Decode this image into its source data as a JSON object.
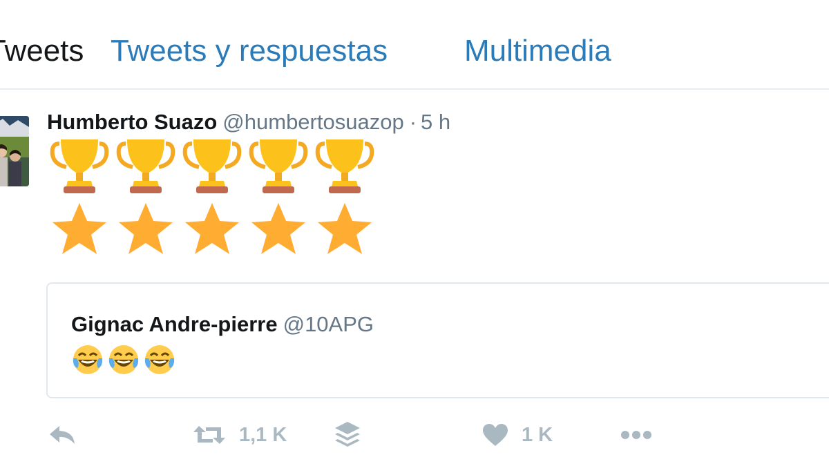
{
  "tabs": {
    "tweets": "Tweets",
    "replies": "Tweets y respuestas",
    "media": "Multimedia"
  },
  "tweet": {
    "author_name": "Humberto Suazo",
    "author_handle": "@humbertosuazop",
    "separator": "·",
    "time": "5 h",
    "content_emojis": [
      "trophy-emoji",
      "star-emoji"
    ],
    "trophy_count": 5,
    "star_count": 5,
    "quoted": {
      "author_name": "Gignac Andre-pierre",
      "author_handle": "@10APG",
      "emoji": "face-with-tears-of-joy-emoji",
      "emoji_count": 3
    },
    "actions": {
      "reply_icon": "reply-icon",
      "retweet_icon": "retweet-icon",
      "retweet_count": "1,1 K",
      "buffer_icon": "layers-icon",
      "like_icon": "heart-icon",
      "like_count": "1 K",
      "more_icon": "more-icon"
    }
  },
  "colors": {
    "tab_active": "#14171a",
    "tab_link": "#2b7bb9",
    "secondary_text": "#657786",
    "action_gray": "#aab8c2",
    "trophy_gold": "#fcc21b",
    "star_gold": "#ffac33",
    "divider": "#e6ecf0"
  }
}
